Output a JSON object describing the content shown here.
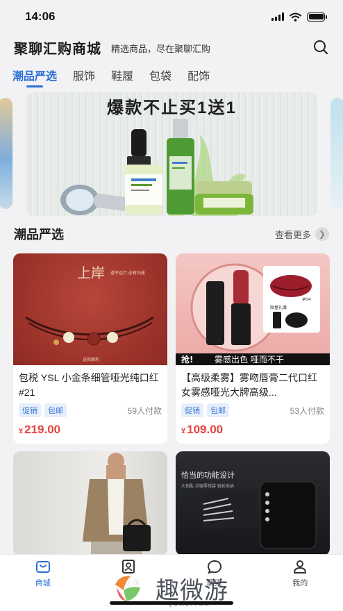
{
  "status_bar": {
    "time": "14:06"
  },
  "header": {
    "title": "聚聊汇购商城",
    "slogan": "精选商品，尽在聚聊汇购"
  },
  "tabs": [
    {
      "label": "潮品严选",
      "active": true
    },
    {
      "label": "服饰"
    },
    {
      "label": "鞋履"
    },
    {
      "label": "包袋"
    },
    {
      "label": "配饰"
    }
  ],
  "banner": {
    "headline": "爆款不止买1送1"
  },
  "section": {
    "title": "潮品严选",
    "more": "查看更多"
  },
  "products": [
    {
      "title": "包税 YSL 小金条细管哑光纯口红 #21",
      "tags": [
        "促销",
        "包邮"
      ],
      "sales": "59人付款",
      "currency": "¥",
      "price": "219.00",
      "image_text": {
        "big": "上岸",
        "small": "道不远行 必有归途",
        "foot": "送你顺利"
      }
    },
    {
      "title": "【高级柔雾】雾吻唇膏二代口红女雾感哑光大牌高级...",
      "tags": [
        "促销",
        "包邮"
      ],
      "sales": "53人付款",
      "currency": "¥",
      "price": "109.00",
      "image_text": {
        "band_a": "抢!",
        "band_b": "雾感出色 哑而不干",
        "box": "限量礼赠",
        "num": "#04"
      }
    },
    {
      "title": "",
      "tags": [],
      "sales": "",
      "price": ""
    },
    {
      "title": "",
      "image_text": {
        "heading": "恰当的功能设计",
        "sub": "大钥匙 拉链零钱袋 轻松收纳"
      }
    }
  ],
  "tabbar": [
    {
      "label": "商城",
      "icon": "shop-bag-icon",
      "active": true
    },
    {
      "label": "通讯录",
      "icon": "contacts-icon"
    },
    {
      "label": "聊天",
      "icon": "chat-bubble-icon"
    },
    {
      "label": "我的",
      "icon": "person-icon"
    }
  ],
  "watermark": {
    "text": "趣微游",
    "sub": "QUWEIYOU"
  },
  "colors": {
    "accent": "#2a6fd6",
    "price": "#e64340",
    "background": "#f2f2f4"
  }
}
